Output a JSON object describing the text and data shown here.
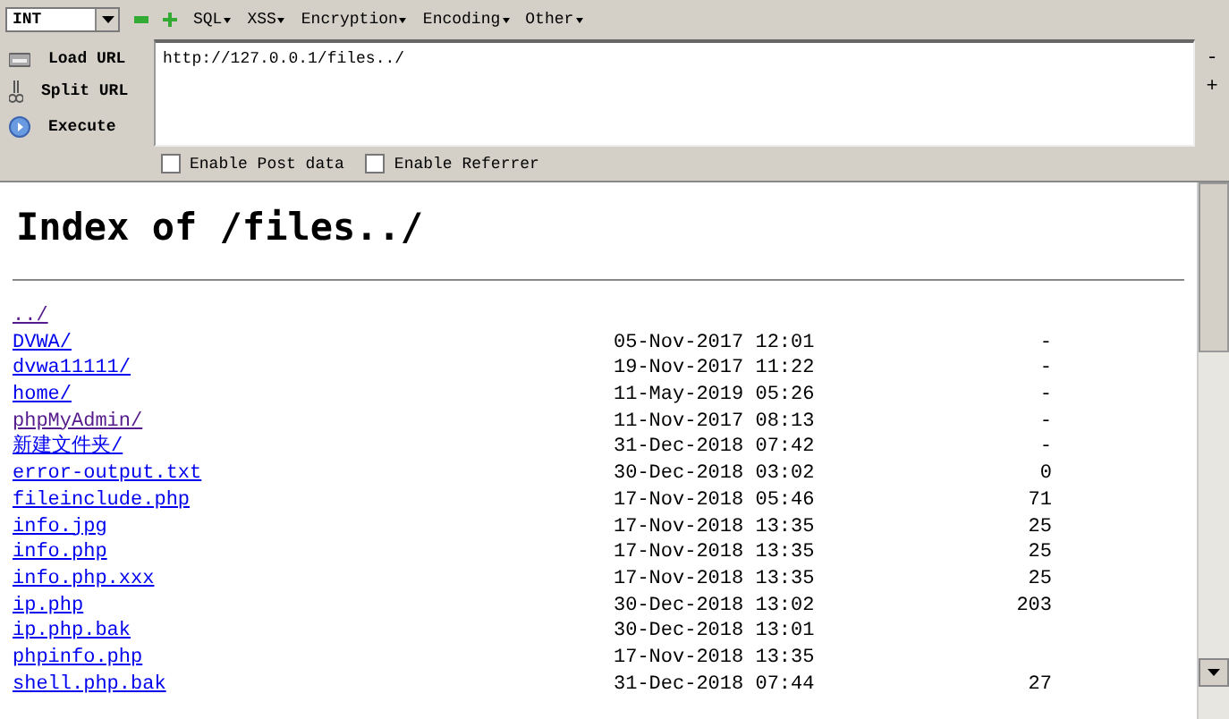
{
  "toolbar": {
    "dropdown": {
      "value": "INT"
    },
    "menus": [
      "SQL",
      "XSS",
      "Encryption",
      "Encoding",
      "Other"
    ]
  },
  "actions": [
    {
      "kind": "load",
      "label": "Load URL"
    },
    {
      "kind": "split",
      "label": "Split URL"
    },
    {
      "kind": "execute",
      "label": "Execute"
    }
  ],
  "url_field": {
    "value": "http://127.0.0.1/files../"
  },
  "zoom": [
    "-",
    "+"
  ],
  "options": [
    {
      "label": "Enable Post data",
      "checked": false
    },
    {
      "label": "Enable Referrer",
      "checked": false
    }
  ],
  "page": {
    "heading": "Index of /files../",
    "rows": [
      {
        "name": "../",
        "visited": true,
        "date": "",
        "size": ""
      },
      {
        "name": "DVWA/",
        "visited": false,
        "date": "05-Nov-2017 12:01",
        "size": "-"
      },
      {
        "name": "dvwa11111/",
        "visited": false,
        "date": "19-Nov-2017 11:22",
        "size": "-"
      },
      {
        "name": "home/",
        "visited": false,
        "date": "11-May-2019 05:26",
        "size": "-"
      },
      {
        "name": "phpMyAdmin/",
        "visited": true,
        "date": "11-Nov-2017 08:13",
        "size": "-"
      },
      {
        "name": "新建文件夹/",
        "visited": false,
        "date": "31-Dec-2018 07:42",
        "size": "-"
      },
      {
        "name": "error-output.txt",
        "visited": false,
        "date": "30-Dec-2018 03:02",
        "size": "0"
      },
      {
        "name": "fileinclude.php",
        "visited": false,
        "date": "17-Nov-2018 05:46",
        "size": "71"
      },
      {
        "name": "info.jpg",
        "visited": false,
        "date": "17-Nov-2018 13:35",
        "size": "25"
      },
      {
        "name": "info.php",
        "visited": false,
        "date": "17-Nov-2018 13:35",
        "size": "25"
      },
      {
        "name": "info.php.xxx",
        "visited": false,
        "date": "17-Nov-2018 13:35",
        "size": "25"
      },
      {
        "name": "ip.php",
        "visited": false,
        "date": "30-Dec-2018 13:02",
        "size": "203"
      },
      {
        "name": "ip.php.bak",
        "visited": false,
        "date": "30-Dec-2018 13:01",
        "size": ""
      },
      {
        "name": "phpinfo.php",
        "visited": false,
        "date": "17-Nov-2018 13:35",
        "size": ""
      },
      {
        "name": "shell.php.bak",
        "visited": false,
        "date": "31-Dec-2018 07:44",
        "size": "27"
      }
    ]
  }
}
